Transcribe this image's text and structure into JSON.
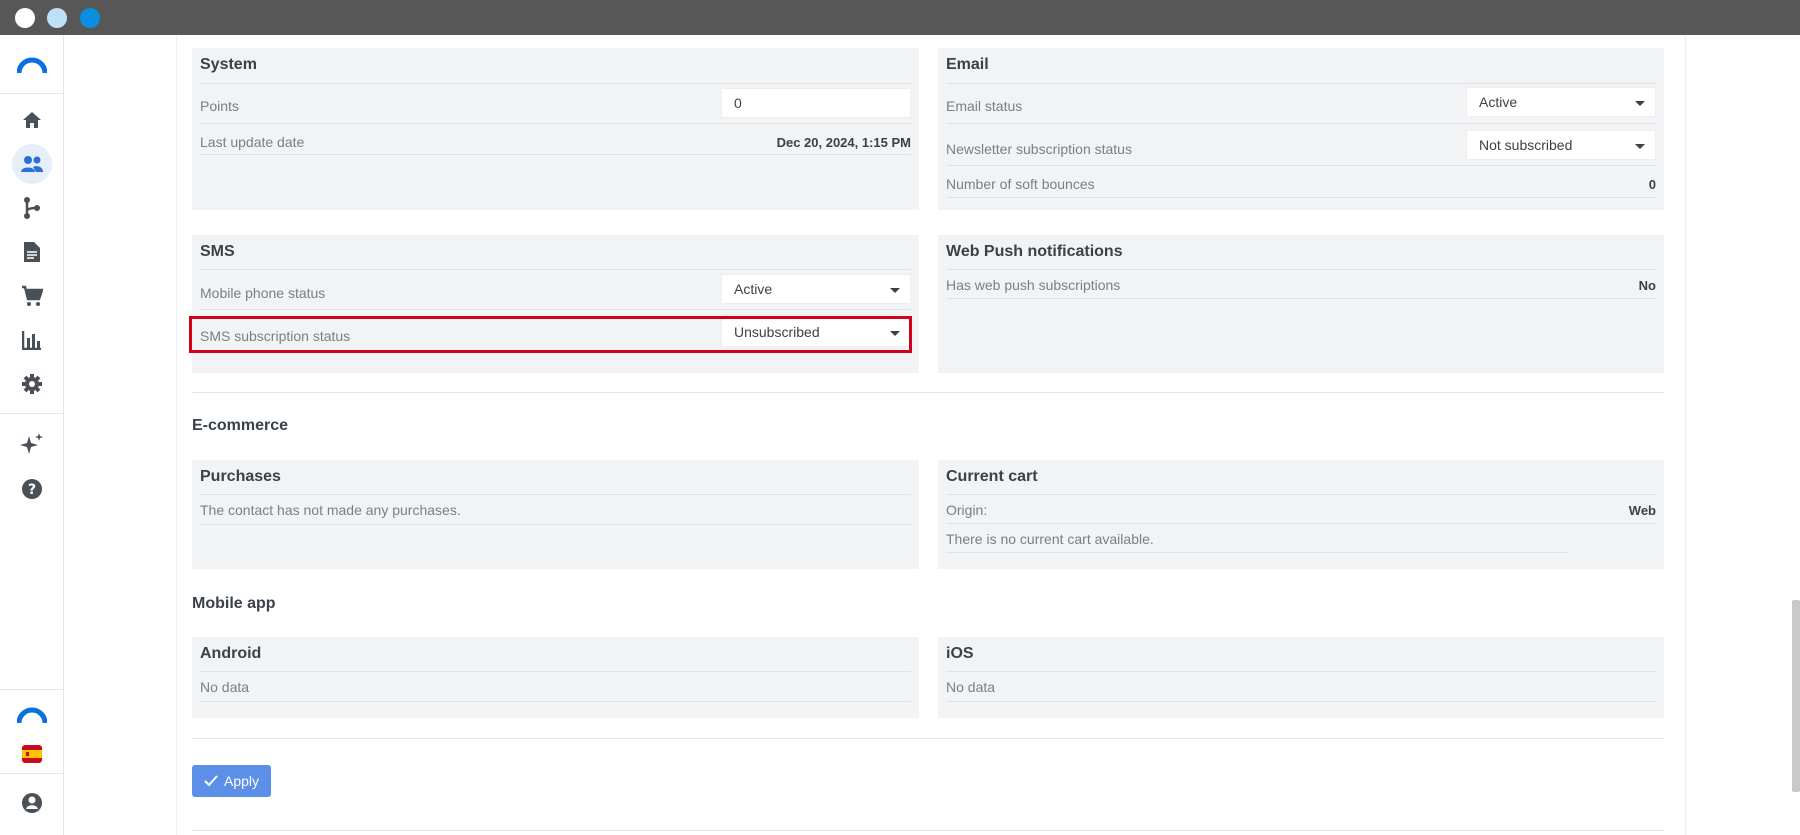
{
  "colors": {
    "accent": "#5b8fe8",
    "highlight": "#d0021b",
    "titlebar": "#575757"
  },
  "window_controls": [
    {
      "name": "close",
      "color": "#ffffff"
    },
    {
      "name": "minimize",
      "color": "#bfe1f7"
    },
    {
      "name": "maximize",
      "color": "#0a8fe0"
    }
  ],
  "sidebar": {
    "items": [
      {
        "icon": "logo-icon"
      },
      {
        "icon": "home-icon"
      },
      {
        "icon": "contacts-icon"
      },
      {
        "icon": "automation-icon"
      },
      {
        "icon": "content-icon"
      },
      {
        "icon": "cart-icon"
      },
      {
        "icon": "reports-icon"
      },
      {
        "icon": "settings-icon"
      },
      {
        "icon": "ai-sparkle-icon"
      },
      {
        "icon": "help-icon"
      },
      {
        "icon": "brand-logo-icon"
      },
      {
        "icon": "spain-flag-icon"
      },
      {
        "icon": "user-account-icon"
      }
    ]
  },
  "system": {
    "title": "System",
    "points_label": "Points",
    "points_value": "0",
    "last_update_label": "Last update date",
    "last_update_value": "Dec 20, 2024, 1:15 PM"
  },
  "email": {
    "title": "Email",
    "status_label": "Email status",
    "status_value": "Active",
    "newsletter_label": "Newsletter subscription status",
    "newsletter_value": "Not subscribed",
    "soft_bounces_label": "Number of soft bounces",
    "soft_bounces_value": "0"
  },
  "sms": {
    "title": "SMS",
    "mobile_status_label": "Mobile phone status",
    "mobile_status_value": "Active",
    "subscription_label": "SMS subscription status",
    "subscription_value": "Unsubscribed"
  },
  "webpush": {
    "title": "Web Push notifications",
    "has_subs_label": "Has web push subscriptions",
    "has_subs_value": "No"
  },
  "ecommerce": {
    "title": "E-commerce",
    "purchases_title": "Purchases",
    "purchases_text": "The contact has not made any purchases.",
    "cart_title": "Current cart",
    "origin_label": "Origin:",
    "origin_value": "Web",
    "cart_text": "There is no current cart available."
  },
  "mobile_app": {
    "title": "Mobile app",
    "android_title": "Android",
    "android_text": "No data",
    "ios_title": "iOS",
    "ios_text": "No data"
  },
  "apply_label": "Apply"
}
